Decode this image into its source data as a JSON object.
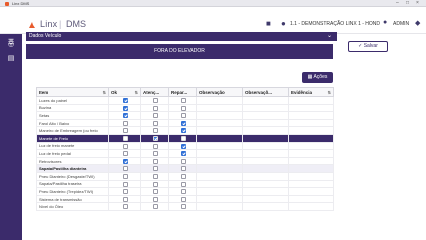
{
  "window": {
    "title": "Linx DMS"
  },
  "header": {
    "brand": "Linx",
    "sep": "|",
    "product": "DMS",
    "location": "1.1 - DEMONSTRAÇÃO LINX 1 - HOND",
    "user": "ADMIN"
  },
  "section": {
    "title": "Dados Veículo"
  },
  "banner": {
    "text": "FORA DO ELEVADOR"
  },
  "actions": {
    "save_label": "Salvar",
    "acoes_label": "Ações"
  },
  "table": {
    "columns": [
      "Item",
      "Ok",
      "Atenç...",
      "Repar...",
      "Observação",
      "Observaçõ...",
      "Evidência"
    ],
    "rows": [
      {
        "label": "Luzes do painel",
        "type": "normal",
        "ok": true,
        "atencao": false,
        "reparo": false
      },
      {
        "label": "Buzina",
        "type": "normal",
        "ok": true,
        "atencao": false,
        "reparo": false
      },
      {
        "label": "Setas",
        "type": "normal",
        "ok": true,
        "atencao": false,
        "reparo": false
      },
      {
        "label": "Farol Alto / Baixo",
        "type": "normal",
        "ok": false,
        "atencao": false,
        "reparo": true
      },
      {
        "label": "Maneiro de Embreagem (ou freio",
        "type": "normal",
        "ok": false,
        "atencao": false,
        "reparo": true
      },
      {
        "label": "Manete de Freio",
        "type": "group",
        "ok": false,
        "atencao": true,
        "reparo": false
      },
      {
        "label": "Luz de freio manete",
        "type": "normal",
        "ok": false,
        "atencao": false,
        "reparo": true
      },
      {
        "label": "Luz de freio pedal",
        "type": "normal",
        "ok": false,
        "atencao": false,
        "reparo": true
      },
      {
        "label": "Retrovisores",
        "type": "normal",
        "ok": true,
        "atencao": false,
        "reparo": false
      },
      {
        "label": "Sapata/Pastilha dianteira",
        "type": "highlight",
        "ok": false,
        "atencao": false,
        "reparo": false
      },
      {
        "label": "Pneu Dianteiro (Desgaste/TWI)",
        "type": "normal",
        "ok": false,
        "atencao": false,
        "reparo": false
      },
      {
        "label": "Sapata/Pastilha traseira",
        "type": "normal",
        "ok": false,
        "atencao": false,
        "reparo": false
      },
      {
        "label": "Pneu Dianteiro (Trepidez/TWI)",
        "type": "normal",
        "ok": false,
        "atencao": false,
        "reparo": false
      },
      {
        "label": "Sistema de transmissão",
        "type": "normal",
        "ok": false,
        "atencao": false,
        "reparo": false
      },
      {
        "label": "Nível do Óleo",
        "type": "normal",
        "ok": false,
        "atencao": false,
        "reparo": false
      }
    ]
  }
}
